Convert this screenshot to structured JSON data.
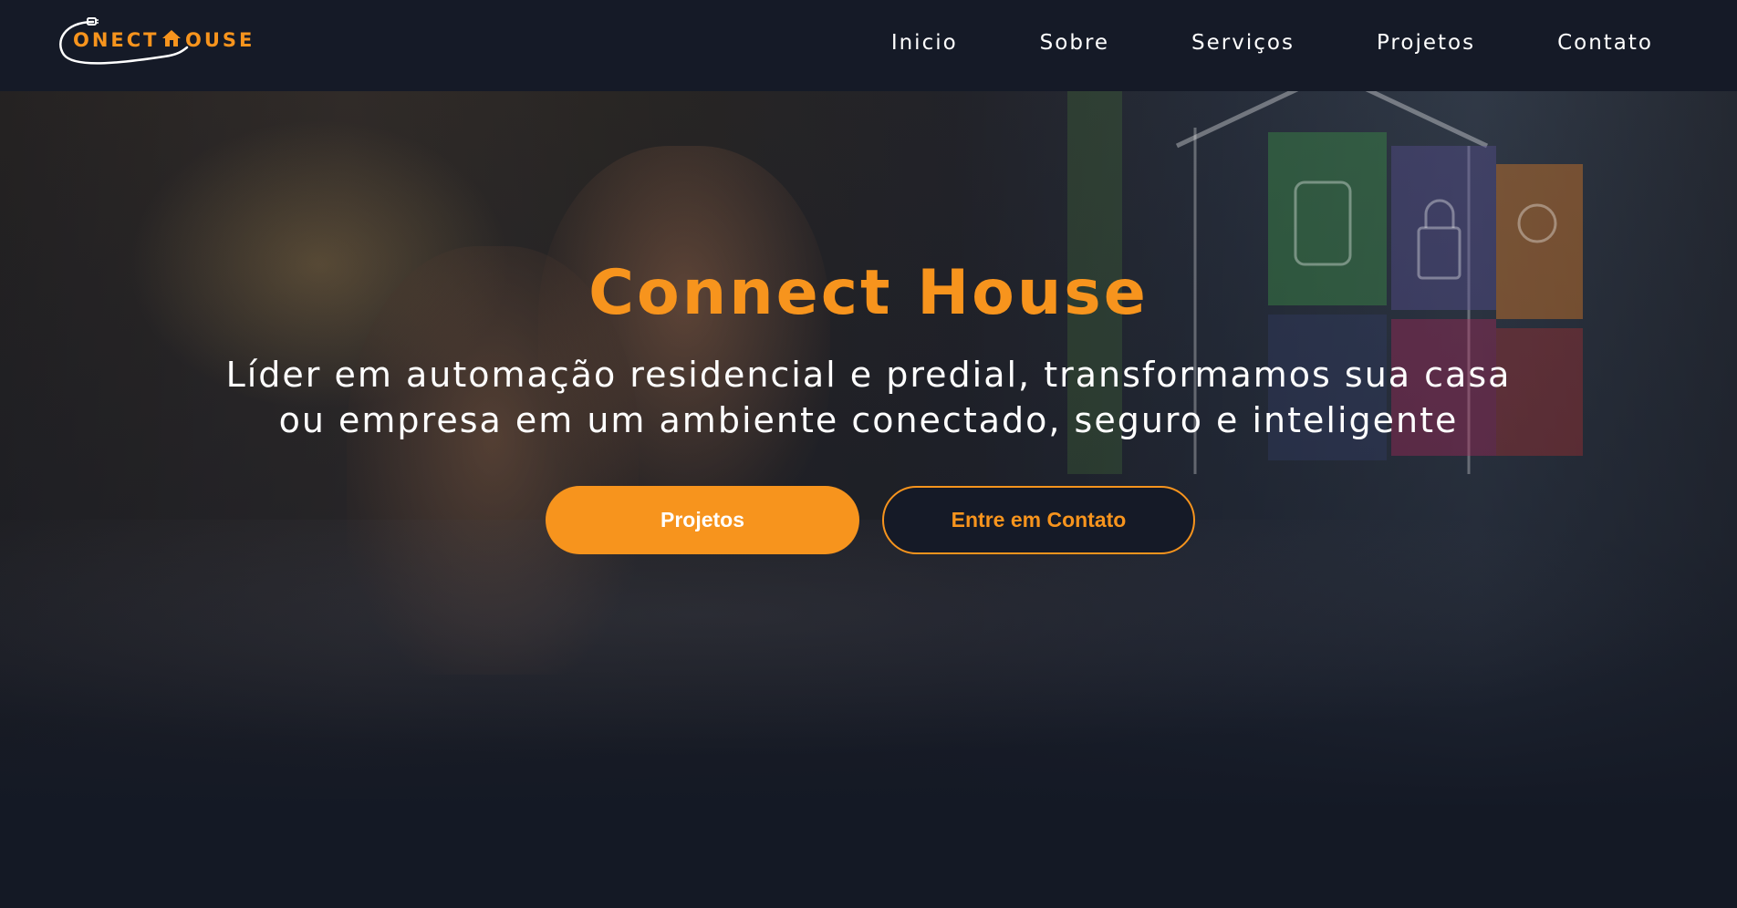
{
  "brand": {
    "logo_part_1": "ONECT",
    "logo_part_2": "OUSE",
    "logo_icon": "house-icon"
  },
  "nav": {
    "items": [
      {
        "label": "Inicio"
      },
      {
        "label": "Sobre"
      },
      {
        "label": "Serviços"
      },
      {
        "label": "Projetos"
      },
      {
        "label": "Contato"
      }
    ]
  },
  "hero": {
    "title": "Connect House",
    "subtitle_line_1": "Líder em automação residencial e predial, transformamos sua casa",
    "subtitle_line_2": "ou empresa em um ambiente conectado, seguro e inteligente",
    "primary_button": "Projetos",
    "secondary_button": "Entre em Contato"
  },
  "colors": {
    "accent": "#f7941d",
    "navbar_bg": "#151a27",
    "page_bg": "#141925",
    "text": "#ffffff"
  }
}
